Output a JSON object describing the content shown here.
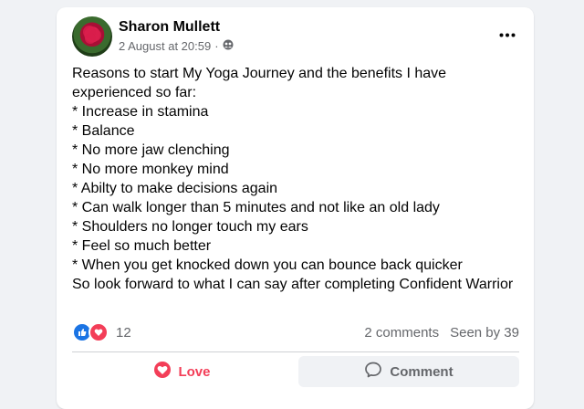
{
  "post": {
    "author": "Sharon Mullett",
    "date": "2 August at 20:59",
    "separator": "·",
    "privacy_icon": "friends-icon",
    "text": "Reasons to start My Yoga Journey and the benefits I have experienced so far:\n* Increase in stamina\n* Balance\n* No more jaw clenching\n* No more monkey mind\n* Abilty to make decisions again\n* Can walk longer than 5 minutes and not like an old lady\n* Shoulders no longer touch my ears\n* Feel so much better\n* When you get knocked down you can bounce back quicker\nSo look forward to what I can say after completing Confident Warrior"
  },
  "stats": {
    "reaction_icons": [
      "like-icon",
      "love-icon"
    ],
    "reaction_count": "12",
    "comments": "2 comments",
    "seen": "Seen by 39"
  },
  "actions": {
    "love_label": "Love",
    "comment_label": "Comment"
  },
  "colors": {
    "love": "#f33e58",
    "like": "#1b74e4",
    "secondary_text": "#65676b"
  }
}
